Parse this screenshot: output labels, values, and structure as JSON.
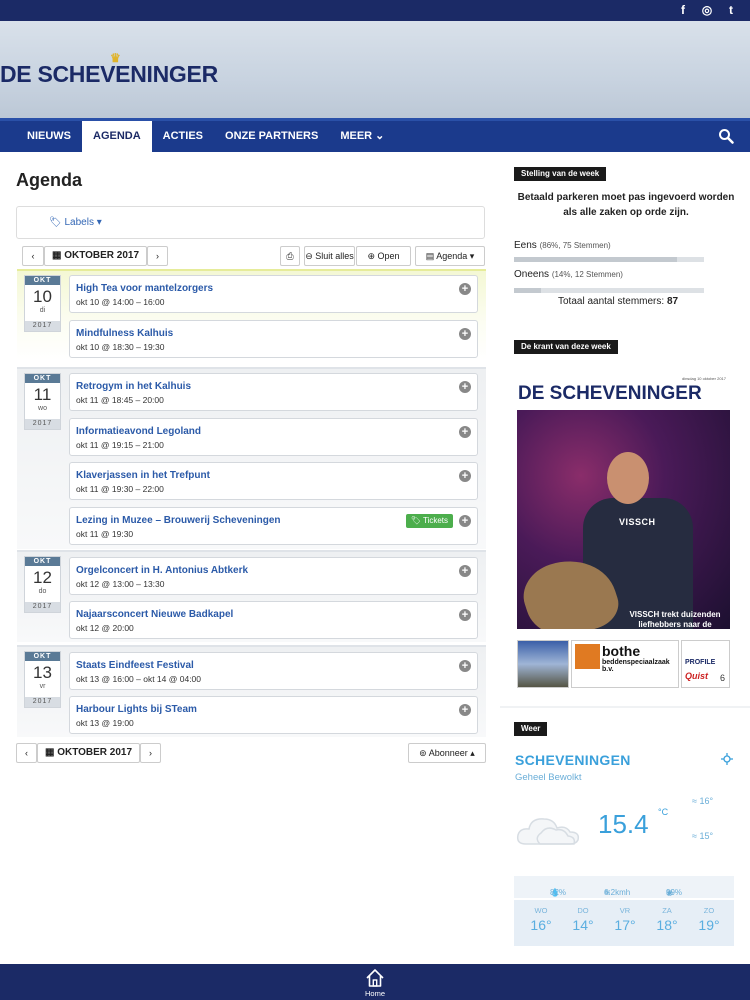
{
  "social": {
    "facebook": "f",
    "instagram": "◎",
    "twitter": "t"
  },
  "brand": {
    "logo_text": "DE SCHEVENINGER",
    "crown": "♛"
  },
  "nav": {
    "items": [
      "NIEUWS",
      "AGENDA",
      "ACTIES",
      "ONZE PARTNERS",
      "MEER"
    ],
    "active": "AGENDA",
    "more_caret": "⌄"
  },
  "agenda": {
    "title": "Agenda",
    "labels_button": "Labels",
    "labels_caret": "▾",
    "month": "OKTOBER 2017",
    "prev": "‹",
    "next": "›",
    "print": "⎙",
    "collapse_all": "Sluit alles",
    "expand_all": "Open alles",
    "view": "Agenda",
    "subscribe": "Abonneer",
    "days": [
      {
        "month": "OKT",
        "day": "10",
        "weekday": "di",
        "year": "2017",
        "events": [
          {
            "title": "High Tea voor mantelzorgers",
            "time": "okt 10 @ 14:00 – 16:00"
          },
          {
            "title": "Mindfulness Kalhuis",
            "time": "okt 10 @ 18:30 – 19:30"
          }
        ]
      },
      {
        "month": "OKT",
        "day": "11",
        "weekday": "wo",
        "year": "2017",
        "events": [
          {
            "title": "Retrogym in het Kalhuis",
            "time": "okt 11 @ 18:45 – 20:00"
          },
          {
            "title": "Informatieavond Legoland",
            "time": "okt 11 @ 19:15 – 21:00"
          },
          {
            "title": "Klaverjassen in het Trefpunt",
            "time": "okt 11 @ 19:30 – 22:00"
          },
          {
            "title": "Lezing in Muzee – Brouwerij Scheveningen",
            "time": "okt 11 @ 19:30",
            "tickets": "Tickets"
          }
        ]
      },
      {
        "month": "OKT",
        "day": "12",
        "weekday": "do",
        "year": "2017",
        "events": [
          {
            "title": "Orgelconcert in H. Antonius Abtkerk",
            "time": "okt 12 @ 13:00 – 13:30"
          },
          {
            "title": "Najaarsconcert Nieuwe Badkapel",
            "time": "okt 12 @ 20:00"
          }
        ]
      },
      {
        "month": "OKT",
        "day": "13",
        "weekday": "vr",
        "year": "2017",
        "events": [
          {
            "title": "Staats Eindfeest Festival",
            "time": "okt 13 @ 16:00 – okt 14 @ 04:00"
          },
          {
            "title": "Harbour Lights bij STeam",
            "time": "okt 13 @ 19:00"
          }
        ]
      }
    ]
  },
  "poll": {
    "widget_title": "Stelling van de week",
    "question": "Betaald parkeren moet pas ingevoerd worden als alle zaken op orde zijn.",
    "options": [
      {
        "label": "Eens",
        "detail": "(86%, 75 Stemmen)",
        "share": 0.86
      },
      {
        "label": "Oneens",
        "detail": "(14%, 12 Stemmen)",
        "share": 0.14
      }
    ],
    "total_label": "Totaal aantal stemmers:",
    "total": "87"
  },
  "newspaper": {
    "widget_title": "De krant van deze week",
    "logo": "DE SCHEVENINGER",
    "date": "dinsdag 10 oktober 2017",
    "shirt": "VISSCH",
    "caption": "VISSCH trekt duizenden liefhebbers naar de visafslag",
    "ad_bothe": "bothe",
    "ad_bothe_sub": "beddenspeciaalzaak b.v.",
    "ad_profile": "PROFILE",
    "ad_quist": "Quist",
    "ad_page": "6"
  },
  "weather": {
    "widget_title": "Weer",
    "city": "SCHEVENINGEN",
    "description": "Geheel Bewolkt",
    "temp": "15.4",
    "unit": "°C",
    "high": "16°",
    "low": "15°",
    "humidity": "82%",
    "wind": "6.2kmh",
    "clouds": "99%",
    "forecast": [
      {
        "day": "WO",
        "temp": "16°"
      },
      {
        "day": "DO",
        "temp": "14°"
      },
      {
        "day": "VR",
        "temp": "17°"
      },
      {
        "day": "ZA",
        "temp": "18°"
      },
      {
        "day": "ZO",
        "temp": "19°"
      }
    ]
  },
  "footer": {
    "home_label": "Home"
  }
}
